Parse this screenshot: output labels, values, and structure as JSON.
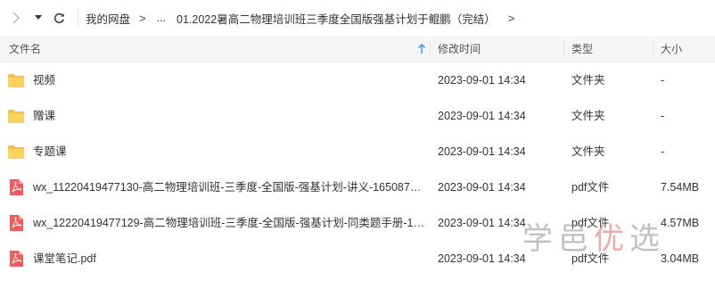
{
  "breadcrumb": {
    "root": "我的网盘",
    "ellipsis": "...",
    "current": "01.2022暑高二物理培训班三季度全国版强基计划于鲲鹏（完结）"
  },
  "columns": {
    "name": "文件名",
    "modified": "修改时间",
    "type": "类型",
    "size": "大小"
  },
  "files": [
    {
      "name": "视频",
      "date": "2023-09-01 14:34",
      "type": "文件夹",
      "size": "-",
      "icon": "folder-icon"
    },
    {
      "name": "赠课",
      "date": "2023-09-01 14:34",
      "type": "文件夹",
      "size": "-",
      "icon": "folder-icon"
    },
    {
      "name": "专题课",
      "date": "2023-09-01 14:34",
      "type": "文件夹",
      "size": "-",
      "icon": "folder-icon"
    },
    {
      "name": "wx_11220419477130-高二物理培训班-三季度-全国版-强基计划-讲义-1650878...",
      "date": "2023-09-01 14:34",
      "type": "pdf文件",
      "size": "7.54MB",
      "icon": "pdf-icon"
    },
    {
      "name": "wx_12220419477129-高二物理培训班-三季度-全国版-强基计划-同类题手册-16...",
      "date": "2023-09-01 14:34",
      "type": "pdf文件",
      "size": "4.57MB",
      "icon": "pdf-icon"
    },
    {
      "name": "课堂笔记.pdf",
      "date": "2023-09-01 14:34",
      "type": "pdf文件",
      "size": "3.04MB",
      "icon": "pdf-icon"
    }
  ],
  "watermark": {
    "part1": "学邑",
    "part2": "优",
    "part3": "选"
  },
  "colors": {
    "folder": "#f7c244",
    "pdf": "#ee5e5e",
    "sort_arrow": "#3a8ef0",
    "header_bg": "#f5f6f8"
  }
}
